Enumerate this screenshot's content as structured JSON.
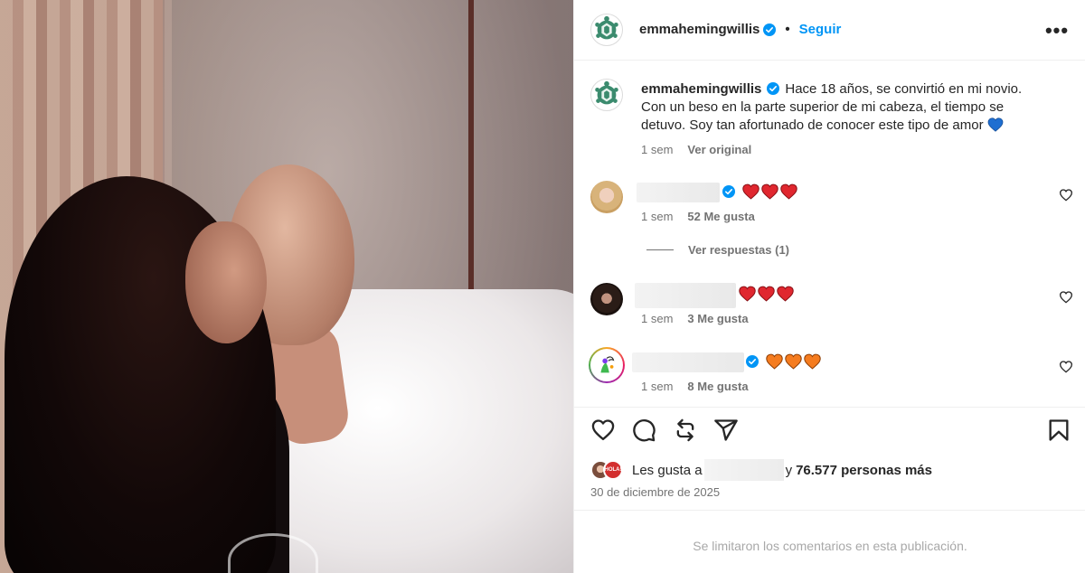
{
  "post": {
    "image_alt": "photo"
  },
  "header": {
    "username": "emmahemingwillis",
    "separator": "•",
    "follow_label": "Seguir",
    "more_label": "•••"
  },
  "caption": {
    "username": "emmahemingwillis",
    "text": "Hace 18 años, se convirtió en mi novio. Con un beso en la parte superior de mi cabeza, el tiempo se detuvo. Soy tan afortunado de conocer este tipo de amor",
    "time": "1 sem",
    "see_original": "Ver original"
  },
  "comments": [
    {
      "time": "1 sem",
      "likes": "52 Me gusta",
      "emojis": [
        "red-heart",
        "red-heart",
        "red-heart"
      ]
    },
    {
      "time": "1 sem",
      "likes": "3 Me gusta",
      "emojis": [
        "red-heart",
        "red-heart",
        "red-heart"
      ]
    },
    {
      "time": "1 sem",
      "likes": "8 Me gusta",
      "emojis": [
        "orange-heart",
        "orange-heart",
        "orange-heart"
      ]
    }
  ],
  "replies": {
    "label": "Ver respuestas (1)"
  },
  "likes": {
    "prefix": "Les gusta a",
    "connector": "y",
    "count": "76.577 personas más",
    "mini_avatar_badge": "HOLA!"
  },
  "date": "30 de diciembre de 2025",
  "comments_limited": "Se limitaron los comentarios en esta publicación.",
  "icons": {
    "like": "heart-icon",
    "comment": "comment-icon",
    "repost": "repost-icon",
    "share": "send-icon",
    "save": "bookmark-icon",
    "verified": "verified-badge-icon"
  },
  "colors": {
    "accent": "#0095f6",
    "verified": "#0095f6",
    "text": "#262626",
    "muted": "#737373",
    "limited_text": "#a8a8a8"
  }
}
